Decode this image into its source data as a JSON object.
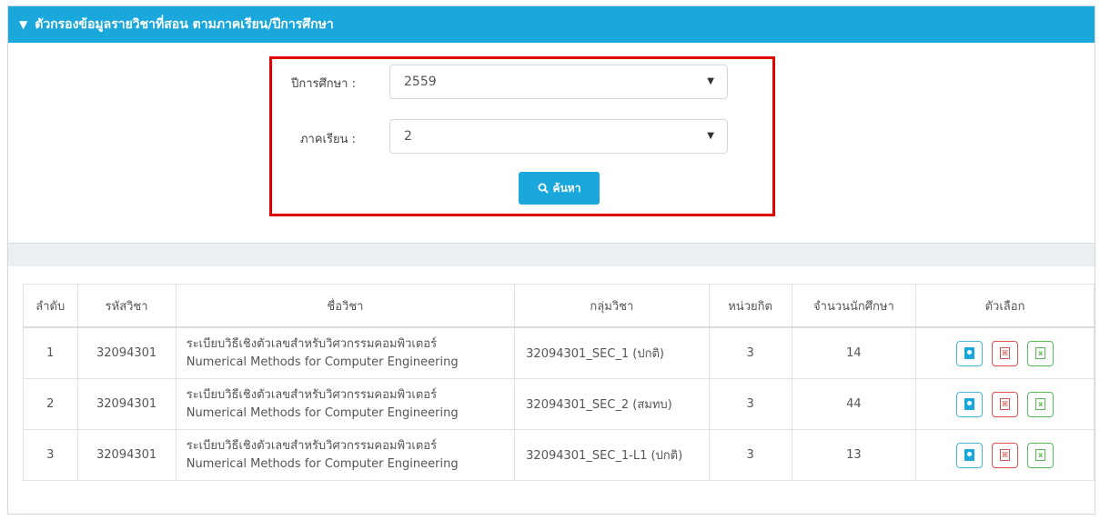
{
  "header": {
    "title": "ตัวกรองข้อมูลรายวิชาที่สอน ตามภาคเรียน/ปีการศึกษา"
  },
  "filter": {
    "year_label": "ปีการศึกษา :",
    "year_value": "2559",
    "term_label": "ภาคเรียน :",
    "term_value": "2",
    "search_label": "ค้นหา"
  },
  "table": {
    "headers": [
      "ลำดับ",
      "รหัสวิชา",
      "ชื่อวิชา",
      "กลุ่มวิชา",
      "หน่วยกิต",
      "จำนวนนักศึกษา",
      "ตัวเลือก"
    ],
    "rows": [
      {
        "no": "1",
        "code": "32094301",
        "name_th": "ระเบียบวิธีเชิงตัวเลขสำหรับวิศวกรรมคอมพิวเตอร์",
        "name_en": "Numerical Methods for Computer Engineering",
        "group": "32094301_SEC_1 (ปกติ)",
        "credits": "3",
        "students": "14"
      },
      {
        "no": "2",
        "code": "32094301",
        "name_th": "ระเบียบวิธีเชิงตัวเลขสำหรับวิศวกรรมคอมพิวเตอร์",
        "name_en": "Numerical Methods for Computer Engineering",
        "group": "32094301_SEC_2 (สมทบ)",
        "credits": "3",
        "students": "44"
      },
      {
        "no": "3",
        "code": "32094301",
        "name_th": "ระเบียบวิธีเชิงตัวเลขสำหรับวิศวกรรมคอมพิวเตอร์",
        "name_en": "Numerical Methods for Computer Engineering",
        "group": "32094301_SEC_1-L1 (ปกติ)",
        "credits": "3",
        "students": "13"
      }
    ]
  },
  "colors": {
    "header": "#1aa7dc",
    "highlight": "#e00000"
  },
  "icons": {
    "filter": "filter-icon",
    "search": "search-icon",
    "contact": "contact-book-icon",
    "pdf": "pdf-file-icon",
    "excel": "excel-file-icon"
  }
}
